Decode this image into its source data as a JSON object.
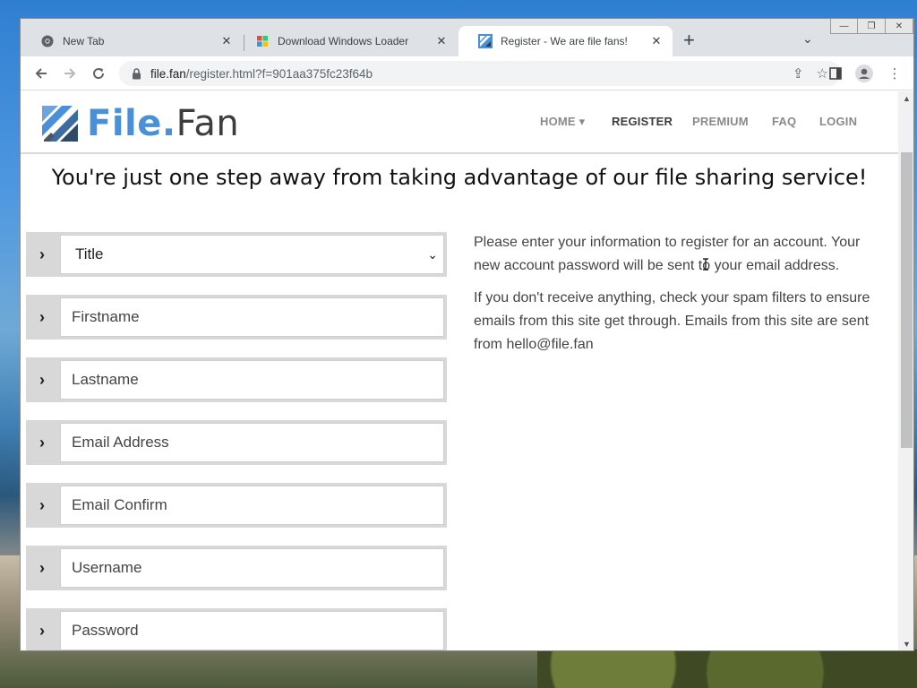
{
  "tabs": [
    {
      "title": "New Tab",
      "icon": "chrome-icon",
      "close": "✕"
    },
    {
      "title": "Download Windows Loader",
      "icon": "windows-icon",
      "close": "✕"
    },
    {
      "title": "Register - We are file fans!",
      "icon": "filefan-icon",
      "close": "✕"
    }
  ],
  "new_tab_label": "+",
  "address_bar": {
    "host": "file.fan",
    "path": "/register.html?f=901aa375fc23f64b"
  },
  "site": {
    "logo": {
      "word1": "File",
      "dot": ".",
      "word2": "Fan"
    },
    "nav": [
      {
        "label": "HOME ▾",
        "active": false
      },
      {
        "label": "REGISTER",
        "active": true
      },
      {
        "label": "PREMIUM",
        "active": false
      },
      {
        "label": "FAQ",
        "active": false
      },
      {
        "label": "LOGIN",
        "active": false
      }
    ],
    "headline": "You're just one step away from taking advantage of our file sharing service!",
    "form": {
      "title_select": {
        "value": "Title",
        "options": [
          "Title"
        ]
      },
      "firstname_placeholder": "Firstname",
      "lastname_placeholder": "Lastname",
      "email_placeholder": "Email Address",
      "email_confirm_placeholder": "Email Confirm",
      "username_placeholder": "Username",
      "password_placeholder": "Password"
    },
    "info": {
      "p1": "Please enter your information to register for an account. Your new account password will be sent to your email address.",
      "p2": "If you don't receive anything, check your spam filters to ensure emails from this site get through. Emails from this site are sent from hello@file.fan"
    }
  },
  "colors": {
    "brand_blue": "#4a90d9",
    "field_bg": "#d8d8d8",
    "tabbar": "#dee1e6"
  }
}
